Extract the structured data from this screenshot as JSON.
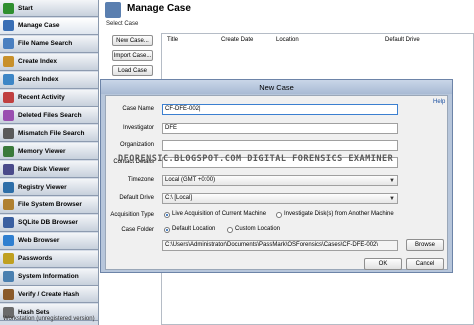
{
  "sidebar": {
    "items": [
      {
        "label": "Start",
        "color": "#2f8f2f"
      },
      {
        "label": "Manage Case",
        "color": "#3a6fb5"
      },
      {
        "label": "File Name Search",
        "color": "#4a7fc0"
      },
      {
        "label": "Create Index",
        "color": "#c8902a"
      },
      {
        "label": "Search Index",
        "color": "#3d86c6"
      },
      {
        "label": "Recent Activity",
        "color": "#c04040"
      },
      {
        "label": "Deleted Files Search",
        "color": "#9a4fb0"
      },
      {
        "label": "Mismatch File Search",
        "color": "#5a5a5a"
      },
      {
        "label": "Memory Viewer",
        "color": "#3a7a3a"
      },
      {
        "label": "Raw Disk Viewer",
        "color": "#4a4a8a"
      },
      {
        "label": "Registry Viewer",
        "color": "#2d6ea8"
      },
      {
        "label": "File System Browser",
        "color": "#b08030"
      },
      {
        "label": "SQLite DB Browser",
        "color": "#3a5fa0"
      },
      {
        "label": "Web Browser",
        "color": "#2f7fd0"
      },
      {
        "label": "Passwords",
        "color": "#c0a020"
      },
      {
        "label": "System Information",
        "color": "#4a80b0"
      },
      {
        "label": "Verify / Create Hash",
        "color": "#8a5a2a"
      },
      {
        "label": "Hash Sets",
        "color": "#6a6a6a"
      }
    ],
    "status": "Workstation (unregistered version)"
  },
  "header": {
    "title": "Manage Case"
  },
  "case_panel": {
    "select_label": "Select Case",
    "buttons": {
      "new": "New Case...",
      "import": "Import Case...",
      "load": "Load Case"
    },
    "columns": [
      "Title",
      "Create Date",
      "Location",
      "Default Drive"
    ]
  },
  "dialog": {
    "title": "New Case",
    "help": "Help",
    "labels": {
      "case_name": "Case Name",
      "investigator": "Investigator",
      "organization": "Organization",
      "contact": "Contact Details",
      "timezone": "Timezone",
      "drive": "Default Drive",
      "acquisition": "Acquisition Type",
      "folder": "Case Folder"
    },
    "values": {
      "case_name": "CF-DFE-002|",
      "investigator": "DFE",
      "organization": "",
      "contact": "",
      "timezone": "Local (GMT +0:00)",
      "drive": "C:\\ [Local]",
      "folder_path": "C:\\Users\\Administrator\\Documents\\PassMark\\OSForensics\\Cases\\CF-DFE-002\\"
    },
    "acquisition_options": [
      "Live Acquisition of Current Machine",
      "Investigate Disk(s) from Another Machine"
    ],
    "folder_options": [
      "Default Location",
      "Custom Location"
    ],
    "buttons": {
      "browse": "Browse",
      "ok": "OK",
      "cancel": "Cancel"
    }
  },
  "watermark": "DFORENSIC.BLOGSPOT.COM DIGITAL FORENSICS EXAMINER"
}
